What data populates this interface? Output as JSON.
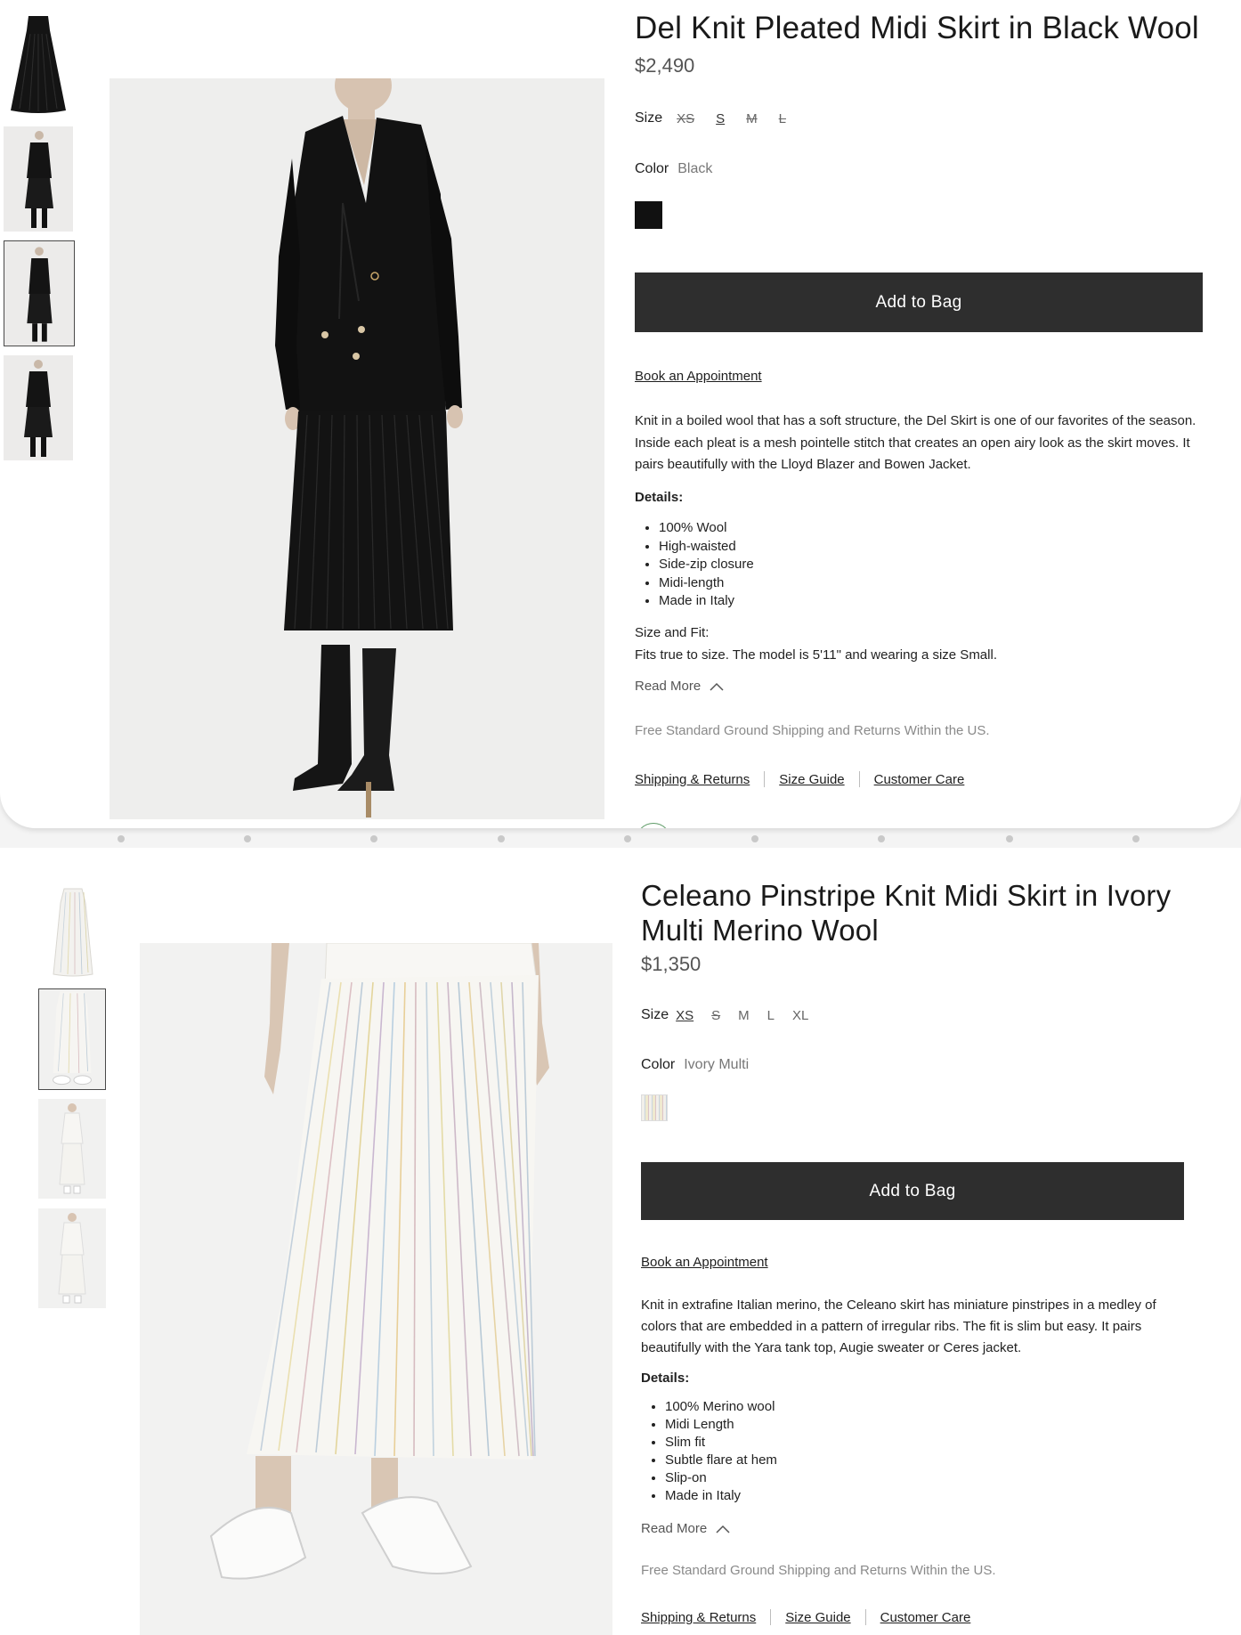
{
  "products": [
    {
      "title": "Del Knit Pleated Midi Skirt in Black Wool",
      "price": "$2,490",
      "size_label": "Size",
      "sizes": [
        "XS",
        "S",
        "M",
        "L"
      ],
      "color_label": "Color",
      "color_value": "Black",
      "swatch_color": "#111111",
      "add_to_bag": "Add to Bag",
      "book_appointment": "Book an Appointment",
      "description": "Knit in a boiled wool that has a soft structure, the Del Skirt is one of our favorites of the season. Inside each pleat is a mesh pointelle stitch that creates an open airy look as the skirt moves. It pairs beautifully with the Lloyd Blazer and Bowen Jacket.",
      "details_heading": "Details:",
      "details": [
        "100% Wool",
        "High-waisted",
        "Side-zip closure",
        "Midi-length",
        "Made in Italy"
      ],
      "fit_heading": "Size and Fit:",
      "fit_text": "Fits true to size. The model is 5'11\" and wearing a size Small.",
      "read_more": "Read More",
      "shipping_note": "Free Standard Ground Shipping and Returns Within the US.",
      "footer_links": [
        "Shipping & Returns",
        "Size Guide",
        "Customer Care"
      ]
    },
    {
      "title": "Celeano Pinstripe Knit Midi Skirt in Ivory Multi Merino Wool",
      "price": "$1,350",
      "size_label": "Size",
      "sizes": [
        "XS",
        "S",
        "M",
        "L",
        "XL"
      ],
      "color_label": "Color",
      "color_value": "Ivory Multi",
      "swatch_color": "#e9e6df",
      "add_to_bag": "Add to Bag",
      "book_appointment": "Book an Appointment",
      "description": "Knit in extrafine Italian merino, the Celeano skirt has miniature pinstripes in a medley of colors that are embedded in a pattern of irregular ribs. The fit is slim but easy. It pairs beautifully with the Yara tank top, Augie sweater or Ceres jacket.",
      "details_heading": "Details:",
      "details": [
        "100% Merino wool",
        "Midi Length",
        "Slim fit",
        "Subtle flare at hem",
        "Slip-on",
        "Made in Italy"
      ],
      "read_more": "Read More",
      "shipping_note": "Free Standard Ground Shipping and Returns Within the US.",
      "footer_links": [
        "Shipping & Returns",
        "Size Guide",
        "Customer Care"
      ]
    }
  ],
  "colors": {
    "button_bg": "#2e2e2e",
    "muted_text": "#8a8a8a",
    "badge_green": "#5f9c68"
  },
  "icons": [
    "chevron-up-icon"
  ]
}
